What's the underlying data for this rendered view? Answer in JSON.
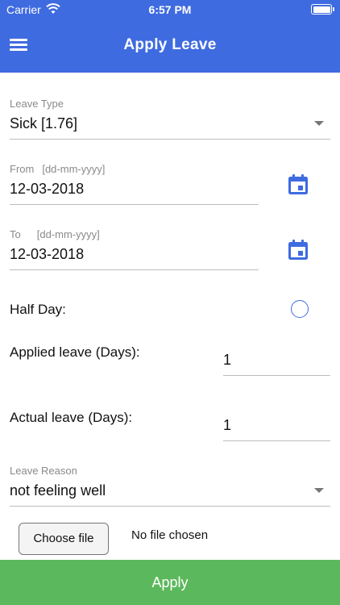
{
  "status_bar": {
    "carrier": "Carrier",
    "time": "6:57 PM",
    "wifi_icon": "wifi-icon",
    "battery_icon": "battery-icon"
  },
  "header": {
    "title": "Apply Leave",
    "menu_icon": "hamburger-menu-icon",
    "color": "#3f6be0"
  },
  "form": {
    "leave_type": {
      "label": "Leave Type",
      "value": "Sick  [1.76]"
    },
    "from": {
      "label": "From",
      "hint": "[dd-mm-yyyy]",
      "value": "12-03-2018",
      "icon": "calendar-icon"
    },
    "to": {
      "label": "To",
      "hint": "[dd-mm-yyyy]",
      "value": "12-03-2018",
      "icon": "calendar-icon"
    },
    "half_day": {
      "label": "Half Day:",
      "checked": false
    },
    "applied_leave": {
      "label": "Applied leave (Days):",
      "value": "1"
    },
    "actual_leave": {
      "label": "Actual leave (Days):",
      "value": "1"
    },
    "leave_reason": {
      "label": "Leave Reason",
      "value": "not feeling well"
    },
    "file": {
      "button_label": "Choose file",
      "status": "No file chosen"
    }
  },
  "apply_button": {
    "label": "Apply",
    "color": "#5cb85c"
  }
}
